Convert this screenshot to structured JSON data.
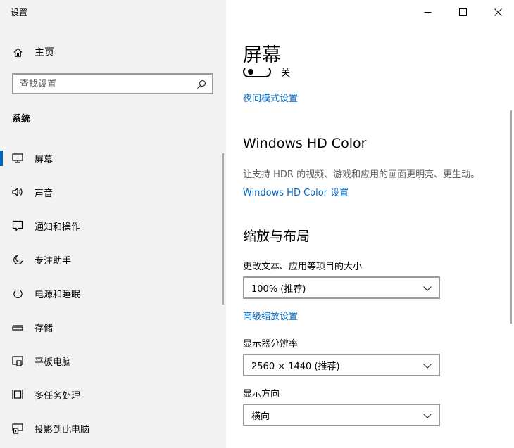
{
  "window": {
    "title": "设置",
    "minimize_icon": "minimize-icon",
    "maximize_icon": "maximize-icon",
    "close_icon": "close-icon"
  },
  "sidebar": {
    "home": {
      "label": "主页",
      "icon": "home-icon"
    },
    "search": {
      "placeholder": "查找设置",
      "icon": "search-icon"
    },
    "section": "系统",
    "items": [
      {
        "label": "屏幕",
        "icon": "monitor-icon",
        "active": true
      },
      {
        "label": "声音",
        "icon": "speaker-icon"
      },
      {
        "label": "通知和操作",
        "icon": "notification-icon"
      },
      {
        "label": "专注助手",
        "icon": "moon-icon"
      },
      {
        "label": "电源和睡眠",
        "icon": "power-icon"
      },
      {
        "label": "存储",
        "icon": "storage-icon"
      },
      {
        "label": "平板电脑",
        "icon": "tablet-icon"
      },
      {
        "label": "多任务处理",
        "icon": "multitask-icon"
      },
      {
        "label": "投影到此电脑",
        "icon": "project-icon"
      }
    ]
  },
  "main": {
    "title": "屏幕",
    "night_light_toggle": {
      "state_label": "关",
      "on": false
    },
    "night_light_link": "夜间模式设置",
    "hdr": {
      "heading": "Windows HD Color",
      "description": "让支持 HDR 的视频、游戏和应用的画面更明亮、更生动。",
      "link": "Windows HD Color 设置"
    },
    "scale": {
      "heading": "缩放与布局",
      "text_size_label": "更改文本、应用等项目的大小",
      "text_size_value": "100% (推荐)",
      "advanced_link": "高级缩放设置",
      "resolution_label": "显示器分辨率",
      "resolution_value": "2560 × 1440 (推荐)",
      "orientation_label": "显示方向",
      "orientation_value": "横向"
    }
  },
  "colors": {
    "accent": "#0067c0",
    "sidebar_bg": "#f2f2f2",
    "content_bg": "#ffffff"
  }
}
